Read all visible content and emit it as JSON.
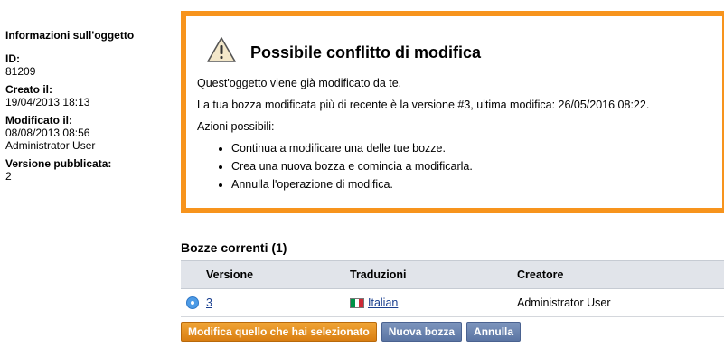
{
  "sidebar": {
    "heading": "Informazioni sull'oggetto",
    "id_label": "ID:",
    "id_value": "81209",
    "created_label": "Creato il:",
    "created_value": "19/04/2013 18:13",
    "modified_label": "Modificato il:",
    "modified_value": "08/08/2013 08:56",
    "modified_by": "Administrator User",
    "published_label": "Versione pubblicata:",
    "published_value": "2"
  },
  "warning": {
    "title": "Possibile conflitto di modifica",
    "line1": "Quest'oggetto viene già modificato da te.",
    "line2": "La tua bozza modificata più di recente è la versione #3, ultima modifica: 26/05/2016 08:22.",
    "line3": "Azioni possibili:",
    "options": [
      "Continua a modificare una delle tue bozze.",
      "Crea una nuova bozza e comincia a modificarla.",
      "Annulla l'operazione di modifica."
    ],
    "border_color": "#f7941d",
    "icon": "warning-triangle-icon"
  },
  "drafts": {
    "title": "Bozze correnti (1)",
    "columns": {
      "version": "Versione",
      "translations": "Traduzioni",
      "creator": "Creatore"
    },
    "rows": [
      {
        "version": "3",
        "translation": "Italian",
        "flag": "italy-flag-icon",
        "creator": "Administrator User",
        "selected": true
      }
    ]
  },
  "actions": {
    "edit_selected": "Modifica quello che hai selezionato",
    "new_draft": "Nuova bozza",
    "cancel": "Annulla"
  }
}
